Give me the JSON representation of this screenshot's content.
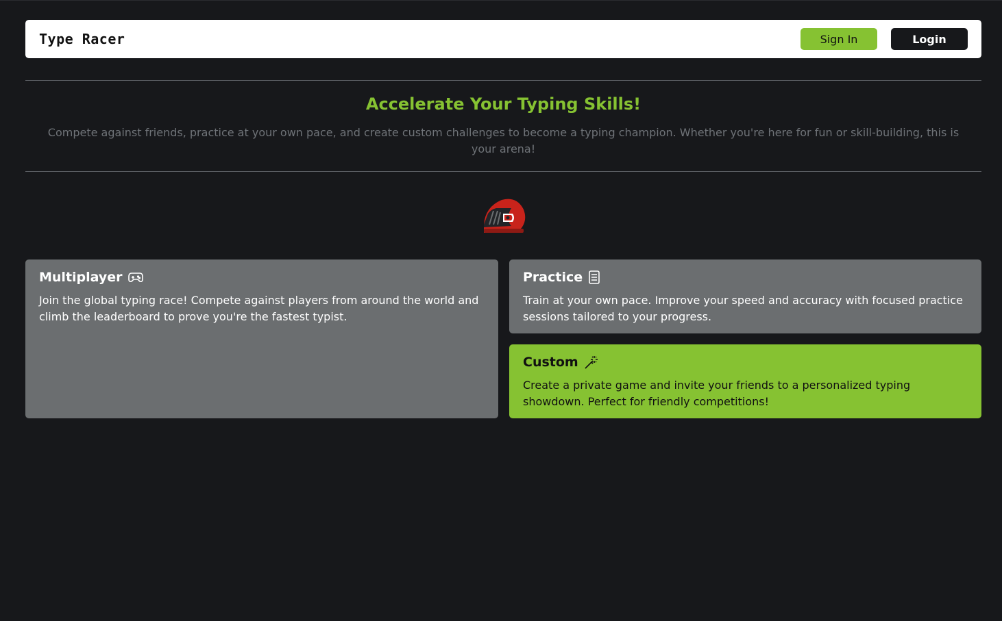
{
  "navbar": {
    "brand": "Type Racer",
    "sign_in_label": "Sign In",
    "login_label": "Login"
  },
  "hero": {
    "title": "Accelerate Your Typing Skills!",
    "subtitle": "Compete against friends, practice at your own pace, and create custom challenges to become a typing champion. Whether you're here for fun or skill-building, this is your arena!"
  },
  "logo": {
    "icon": "racing-helmet-icon"
  },
  "modes": {
    "multiplayer": {
      "title": "Multiplayer",
      "icon": "gamepad-icon",
      "description": "Join the global typing race! Compete against players from around the world and climb the leaderboard to prove you're the fastest typist."
    },
    "practice": {
      "title": "Practice",
      "icon": "document-icon",
      "description": "Train at your own pace. Improve your speed and accuracy with focused practice sessions tailored to your progress."
    },
    "custom": {
      "title": "Custom",
      "icon": "magic-wand-icon",
      "description": "Create a private game and invite your friends to a personalized typing showdown. Perfect for friendly competitions!"
    }
  },
  "colors": {
    "background": "#17181b",
    "accent": "#86c232",
    "card_gray": "#6b6e70",
    "logo_red": "#c8231b"
  }
}
